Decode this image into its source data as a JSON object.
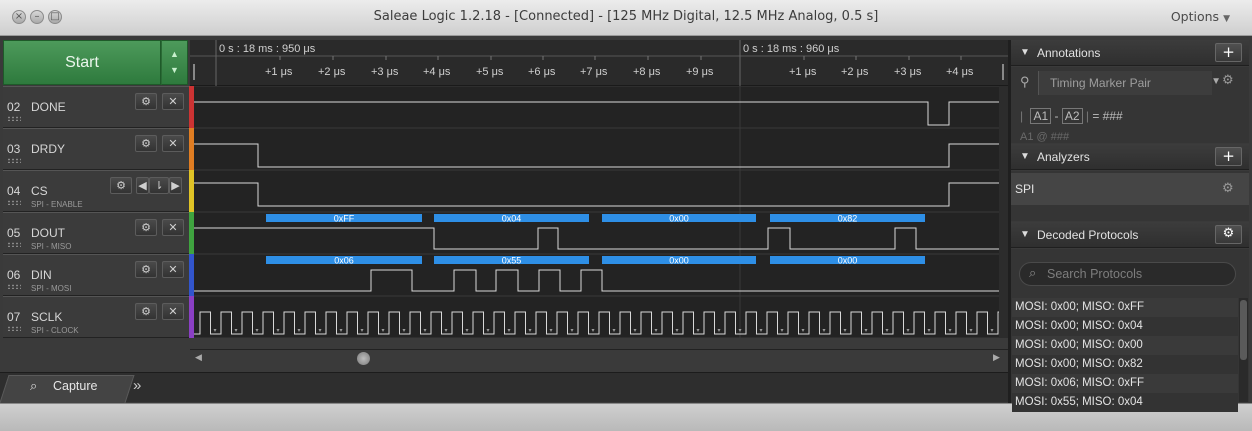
{
  "window": {
    "title": "Saleae Logic 1.2.18 - [Connected] - [125 MHz Digital, 12.5 MHz Analog, 0.5 s]",
    "options_label": "Options"
  },
  "toolbar": {
    "start_label": "Start"
  },
  "ruler": {
    "time_left": "0 s : 18 ms : 950 μs",
    "time_right": "0 s : 18 ms : 960 μs",
    "ticks_left": [
      "+1 μs",
      "+2 μs",
      "+3 μs",
      "+4 μs",
      "+5 μs",
      "+6 μs",
      "+7 μs",
      "+8 μs",
      "+9 μs"
    ],
    "ticks_right": [
      "+1 μs",
      "+2 μs",
      "+3 μs",
      "+4 μs"
    ]
  },
  "channels": [
    {
      "num": "02",
      "name": "DONE",
      "sub": "",
      "color": "#cc3333"
    },
    {
      "num": "03",
      "name": "DRDY",
      "sub": "",
      "color": "#e07d22"
    },
    {
      "num": "04",
      "name": "CS",
      "sub": "SPI - ENABLE",
      "color": "#e0c326"
    },
    {
      "num": "05",
      "name": "DOUT",
      "sub": "SPI - MISO",
      "color": "#3fa33f"
    },
    {
      "num": "06",
      "name": "DIN",
      "sub": "SPI - MOSI",
      "color": "#3255cc"
    },
    {
      "num": "07",
      "name": "SCLK",
      "sub": "SPI - CLOCK",
      "color": "#8a3fc4"
    }
  ],
  "dout_bytes": [
    "0xFF",
    "0x04",
    "0x00",
    "0x82"
  ],
  "din_bytes": [
    "0x06",
    "0x55",
    "0x00",
    "0x00"
  ],
  "annotations": {
    "header": "Annotations",
    "marker": "Timing Marker Pair",
    "a1": "A1",
    "a2": "A2",
    "formula_sep": "-",
    "formula_eq": "= ###",
    "a1_at": "A1 @ ###"
  },
  "analyzers": {
    "header": "Analyzers",
    "items": [
      "SPI"
    ]
  },
  "decoded": {
    "header": "Decoded Protocols",
    "search_placeholder": "Search Protocols",
    "rows": [
      "MOSI: 0x00;  MISO: 0xFF",
      "MOSI: 0x00;  MISO: 0x04",
      "MOSI: 0x00;  MISO: 0x00",
      "MOSI: 0x00;  MISO: 0x82",
      "MOSI: 0x06;  MISO: 0xFF",
      "MOSI: 0x55;  MISO: 0x04"
    ]
  },
  "tabs": {
    "capture": "Capture",
    "more": "»"
  }
}
